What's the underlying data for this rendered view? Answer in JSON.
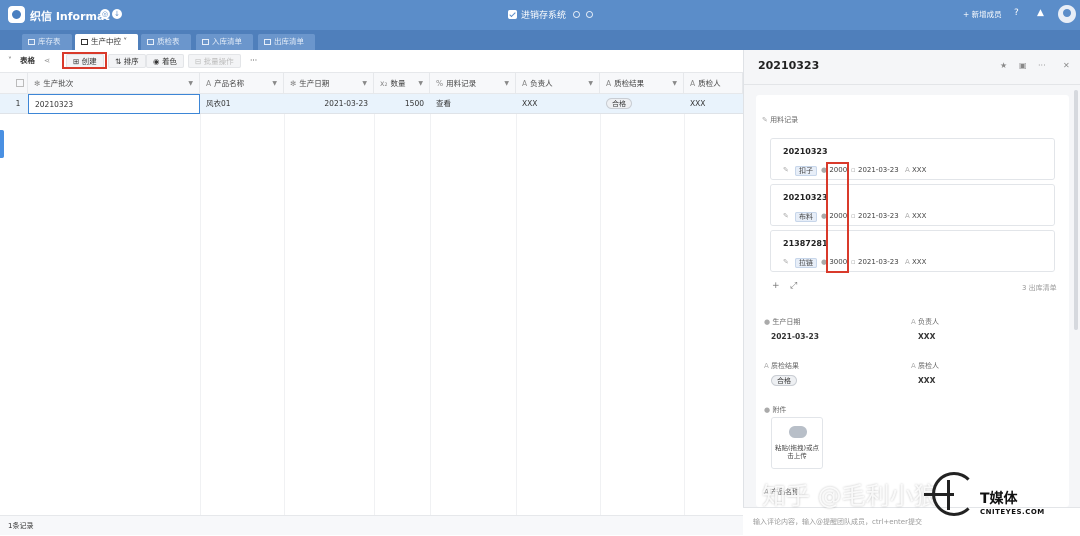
{
  "app": {
    "brand": "织信 Informat",
    "system_title": "进销存系统",
    "new_member": "新增成员"
  },
  "tabs": [
    {
      "label": "库存表",
      "active": false
    },
    {
      "label": "生产中控",
      "active": true
    },
    {
      "label": "质检表",
      "active": false
    },
    {
      "label": "入库清单",
      "active": false
    },
    {
      "label": "出库清单",
      "active": false
    }
  ],
  "toolbar": {
    "view_label": "表格",
    "create": "创建",
    "sort": "排序",
    "color": "着色",
    "batch": "批量操作",
    "more": "···"
  },
  "table": {
    "columns": [
      "生产批次",
      "产品名称",
      "生产日期",
      "数量",
      "用料记录",
      "负责人",
      "质检结果",
      "质检人"
    ],
    "rows": [
      {
        "index": "1",
        "batch": "20210323",
        "product": "风衣01",
        "date": "2021-03-23",
        "qty": "1500",
        "material_link": "查看",
        "owner": "XXX",
        "qc_result": "合格",
        "inspector": "XXX"
      }
    ],
    "footer": "1条记录"
  },
  "panel": {
    "title": "20210323",
    "material_label": "用料记录",
    "records": [
      {
        "id": "20210323",
        "item": "扣子",
        "qty": "2000",
        "date": "2021-03-23",
        "person": "XXX"
      },
      {
        "id": "20210323",
        "item": "布料",
        "qty": "2000",
        "date": "2021-03-23",
        "person": "XXX"
      },
      {
        "id": "21387281",
        "item": "拉链",
        "qty": "3000",
        "date": "2021-03-23",
        "person": "XXX"
      }
    ],
    "outbound_link": "3 出库清单",
    "fields": {
      "date_label": "生产日期",
      "date_value": "2021-03-23",
      "owner_label": "负责人",
      "owner_value": "XXX",
      "qc_label": "质检结果",
      "qc_value": "合格",
      "inspector_label": "质检人",
      "inspector_value": "XXX",
      "attach_label": "附件",
      "upload_text": "粘贴(拖拽)或点击上传",
      "product_label": "产品名称"
    },
    "comment_placeholder": "输入评论内容，输入@提醒团队成员，ctrl+enter提交"
  },
  "watermark": {
    "zhihu": "知乎 @毛利小狼",
    "logo_text": "T媒体",
    "logo_sub": "CNITEYES.COM"
  },
  "colors": {
    "header": "#5b8dc9",
    "selection": "#e9f3fc",
    "highlight": "#d93a2b"
  }
}
